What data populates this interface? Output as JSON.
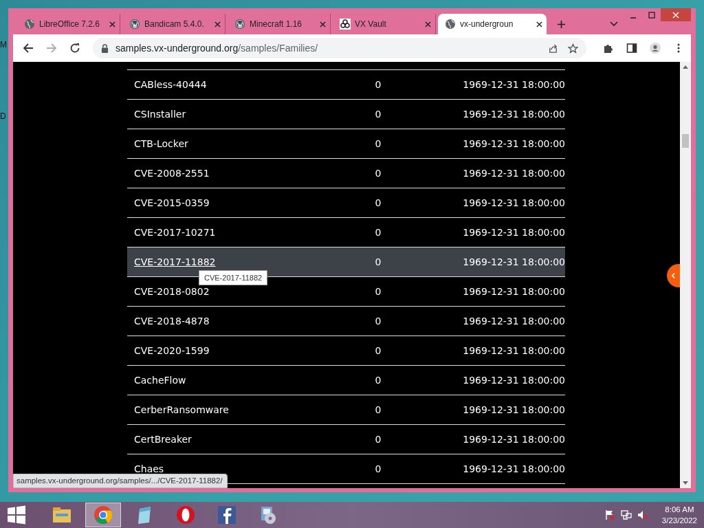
{
  "desktop": {
    "labels": [
      "M",
      "D"
    ]
  },
  "browser": {
    "tabs": [
      {
        "title": "LibreOffice 7.2.6",
        "kind": "globe",
        "selected": false
      },
      {
        "title": "Bandicam 5.4.0.",
        "kind": "wordpress",
        "selected": false
      },
      {
        "title": "Minecraft 1.16",
        "kind": "wordpress",
        "selected": false
      },
      {
        "title": "VX Vault",
        "kind": "biohazard",
        "selected": false
      },
      {
        "title": "vx-undergroun",
        "kind": "globe",
        "selected": true
      }
    ],
    "address": {
      "host": "samples.vx-underground.org",
      "path": "/samples/Families/"
    },
    "rows": [
      {
        "name": "CABless-40444",
        "count": "0",
        "date": "1969-12-31 18:00:00",
        "hovered": false
      },
      {
        "name": "CSInstaller",
        "count": "0",
        "date": "1969-12-31 18:00:00",
        "hovered": false
      },
      {
        "name": "CTB-Locker",
        "count": "0",
        "date": "1969-12-31 18:00:00",
        "hovered": false
      },
      {
        "name": "CVE-2008-2551",
        "count": "0",
        "date": "1969-12-31 18:00:00",
        "hovered": false
      },
      {
        "name": "CVE-2015-0359",
        "count": "0",
        "date": "1969-12-31 18:00:00",
        "hovered": false
      },
      {
        "name": "CVE-2017-10271",
        "count": "0",
        "date": "1969-12-31 18:00:00",
        "hovered": false
      },
      {
        "name": "CVE-2017-11882",
        "count": "0",
        "date": "1969-12-31 18:00:00",
        "hovered": true
      },
      {
        "name": "CVE-2018-0802",
        "count": "0",
        "date": "1969-12-31 18:00:00",
        "hovered": false
      },
      {
        "name": "CVE-2018-4878",
        "count": "0",
        "date": "1969-12-31 18:00:00",
        "hovered": false
      },
      {
        "name": "CVE-2020-1599",
        "count": "0",
        "date": "1969-12-31 18:00:00",
        "hovered": false
      },
      {
        "name": "CacheFlow",
        "count": "0",
        "date": "1969-12-31 18:00:00",
        "hovered": false
      },
      {
        "name": "CerberRansomware",
        "count": "0",
        "date": "1969-12-31 18:00:00",
        "hovered": false
      },
      {
        "name": "CertBreaker",
        "count": "0",
        "date": "1969-12-31 18:00:00",
        "hovered": false
      },
      {
        "name": "Chaes",
        "count": "0",
        "date": "1969-12-31 18:00:00",
        "hovered": false
      }
    ],
    "tooltip": "CVE-2017-11882",
    "status_url": "samples.vx-underground.org/samples/.../CVE-2017-11882/"
  },
  "taskbar": {
    "apps": [
      {
        "kind": "explorer",
        "selected": false
      },
      {
        "kind": "chrome",
        "selected": true
      },
      {
        "kind": "notepad",
        "selected": false
      },
      {
        "kind": "opera",
        "selected": false
      },
      {
        "kind": "facebook",
        "selected": false
      },
      {
        "kind": "installer",
        "selected": false
      }
    ],
    "time": "8:06 AM",
    "date": "3/23/2022"
  }
}
